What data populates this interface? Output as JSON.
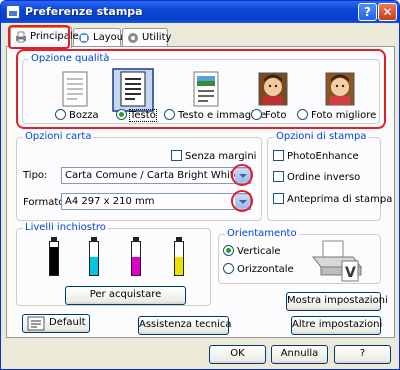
{
  "window": {
    "title": "Preferenze stampa",
    "help_label": "?",
    "close_label": "✕"
  },
  "tabs": [
    {
      "label": "Principale",
      "icon": "printer-icon",
      "active": true
    },
    {
      "label": "Layout",
      "icon": "layout-icon",
      "active": false
    },
    {
      "label": "Utility",
      "icon": "utility-icon",
      "active": false
    }
  ],
  "quality": {
    "title": "Opzione qualità",
    "options": [
      {
        "label": "Bozza",
        "selected": false,
        "icon": "draft-document-icon"
      },
      {
        "label": "Testo",
        "selected": true,
        "icon": "text-document-icon"
      },
      {
        "label": "Testo e immagine",
        "selected": false,
        "icon": "text-image-document-icon"
      },
      {
        "label": "Foto",
        "selected": false,
        "icon": "photo-icon"
      },
      {
        "label": "Foto migliore",
        "selected": false,
        "icon": "best-photo-icon"
      }
    ]
  },
  "paper": {
    "title": "Opzioni carta",
    "borderless_label": "Senza margini",
    "type_label": "Tipo:",
    "type_value": "Carta Comune / Carta Bright White",
    "format_label": "Formato:",
    "format_value": "A4 297 x 210 mm"
  },
  "print_options": {
    "title": "Opzioni di stampa",
    "items": [
      {
        "label": "PhotoEnhance"
      },
      {
        "label": "Ordine inverso"
      },
      {
        "label": "Anteprima di stampa"
      }
    ]
  },
  "ink": {
    "title": "Livelli inchiostro",
    "colors": [
      "#000000",
      "#00c8e0",
      "#e000c8",
      "#f0e000"
    ],
    "levels": [
      0.85,
      0.55,
      0.55,
      0.55
    ],
    "buy_label": "Per acquistare"
  },
  "orientation": {
    "title": "Orientamento",
    "options": [
      {
        "label": "Verticale",
        "selected": true
      },
      {
        "label": "Orizzontale",
        "selected": false
      }
    ]
  },
  "buttons": {
    "show_settings": "Mostra impostazioni",
    "default": "Default",
    "tech_support": "Assistenza tecnica",
    "other_settings": "Altre impostazioni",
    "ok": "OK",
    "cancel": "Annulla",
    "help": "?"
  },
  "colors": {
    "highlight_outline": "#e0202a",
    "group_title": "#0046d5",
    "titlebar": "#0a45d6"
  }
}
